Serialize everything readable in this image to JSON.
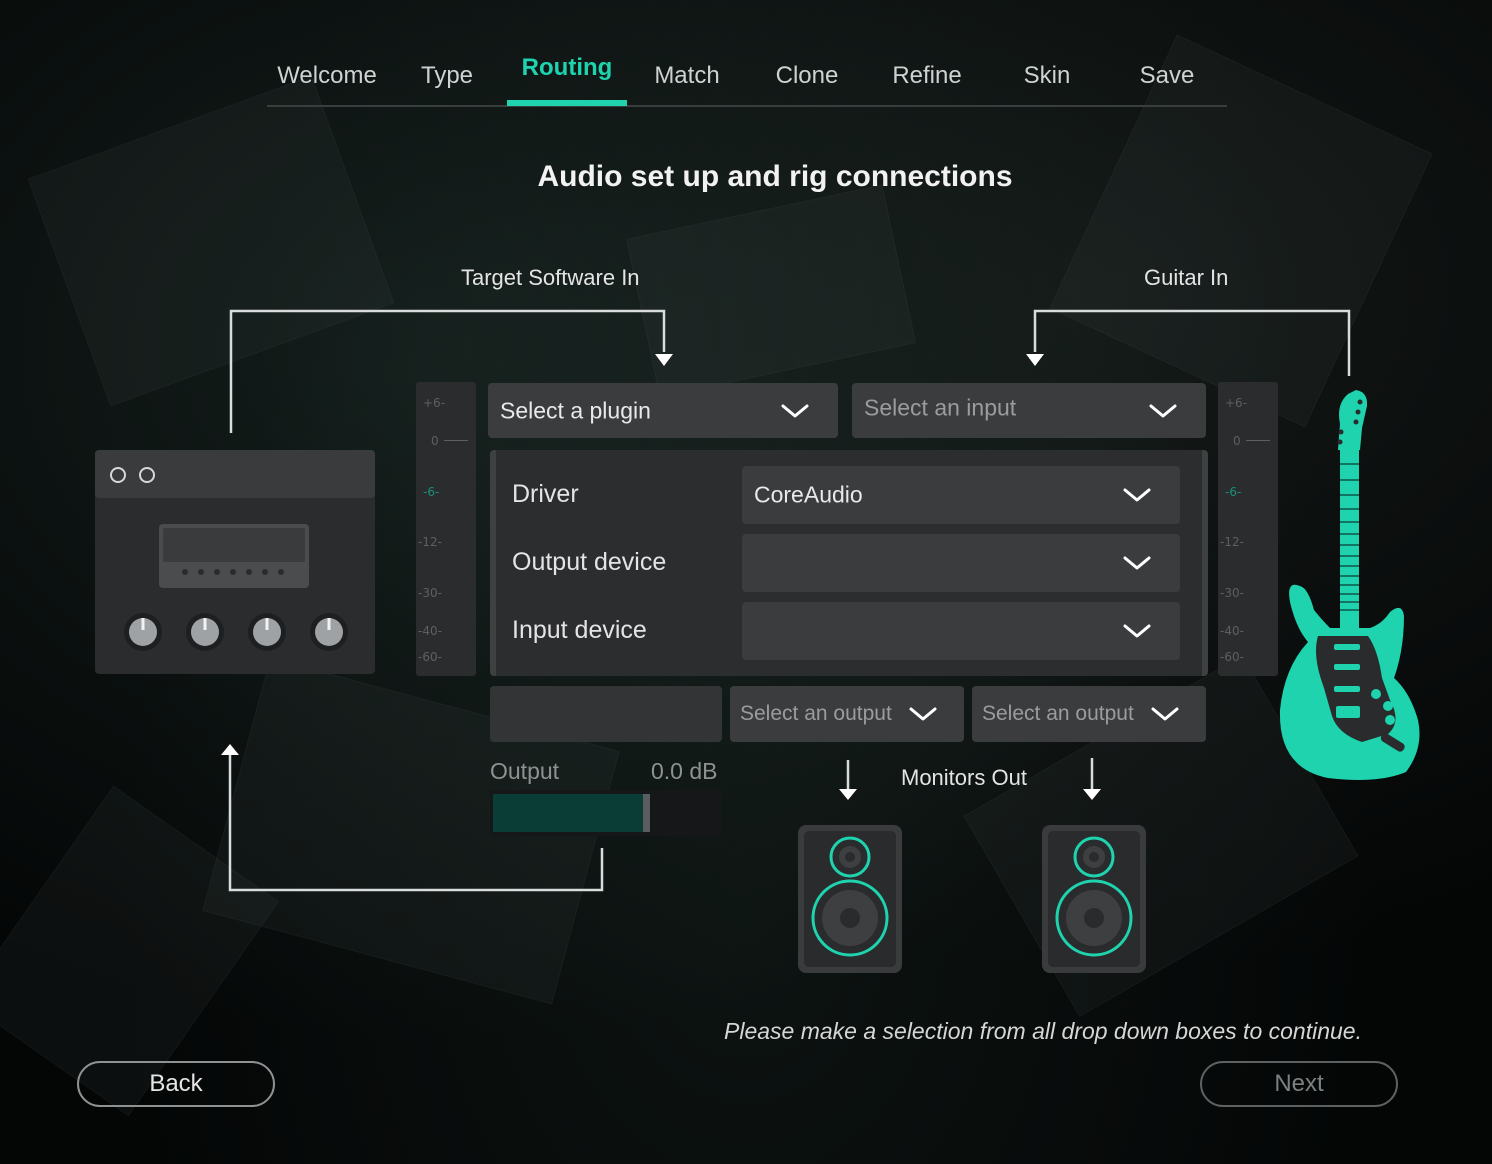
{
  "tabs": [
    "Welcome",
    "Type",
    "Routing",
    "Match",
    "Clone",
    "Refine",
    "Skin",
    "Save"
  ],
  "active_tab": "Routing",
  "page_title": "Audio set up and rig connections",
  "labels": {
    "target_software_in": "Target Software In",
    "guitar_in": "Guitar In",
    "monitors_out": "Monitors Out"
  },
  "plugin_select": {
    "value": "Select a plugin"
  },
  "input_select": {
    "value": "Select an input"
  },
  "audio_settings": {
    "driver_label": "Driver",
    "driver_value": "CoreAudio",
    "output_device_label": "Output device",
    "output_device_value": "",
    "input_device_label": "Input device",
    "input_device_value": ""
  },
  "meter_marks": [
    "+6-",
    "0",
    "-6-",
    "-12-",
    "-30-",
    "-40-",
    "-60-"
  ],
  "output": {
    "label": "Output",
    "value": "0.0 dB",
    "level": 0.68,
    "left_output_select": "Select an output",
    "right_output_select": "Select an output"
  },
  "hint": "Please make a selection from all drop down boxes to continue.",
  "buttons": {
    "back": "Back",
    "next": "Next"
  },
  "colors": {
    "accent": "#1ED3AE",
    "panel": "#2C2D2F",
    "field": "#3B3C3E",
    "background": "#050707"
  },
  "icons": {
    "amp": "amp-head-icon",
    "guitar": "electric-guitar-icon",
    "speaker": "speaker-icon",
    "chevron": "chevron-down-icon"
  }
}
